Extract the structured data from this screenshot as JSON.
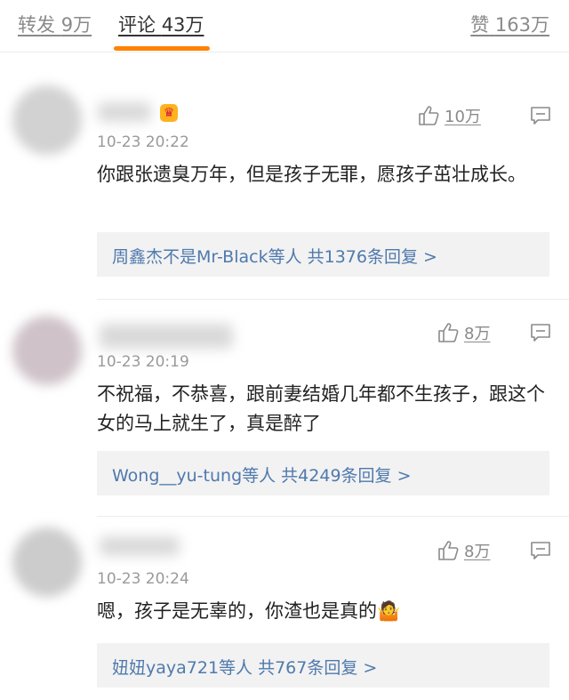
{
  "tabs": {
    "reposts": {
      "label": "转发",
      "count": "9万"
    },
    "comments": {
      "label": "评论",
      "count": "43万"
    },
    "likes": {
      "label": "赞",
      "count": "163万"
    }
  },
  "comments": [
    {
      "vip_badge": "♛",
      "time": "10-23 20:22",
      "text": "你跟张遗臭万年，但是孩子无罪，愿孩子茁壮成长。",
      "likes": "10万",
      "replies_text": "周鑫杰不是Mr-Black等人  共1376条回复 >"
    },
    {
      "time": "10-23 20:19",
      "text": "不祝福，不恭喜，跟前妻结婚几年都不生孩子，跟这个女的马上就生了，真是醉了",
      "likes": "8万",
      "replies_text": "Wong__yu-tung等人  共4249条回复 >"
    },
    {
      "time": "10-23 20:24",
      "text": "嗯，孩子是无辜的，你渣也是真的",
      "emoji": "🤷",
      "likes": "8万",
      "replies_text": "妞妞yaya721等人  共767条回复 >"
    }
  ],
  "colors": {
    "accent": "#ff8200",
    "link": "#4f79ad",
    "muted": "#9a9a9a"
  },
  "icons": {
    "like": "thumbs-up-icon",
    "reply": "comment-bubble-icon"
  }
}
